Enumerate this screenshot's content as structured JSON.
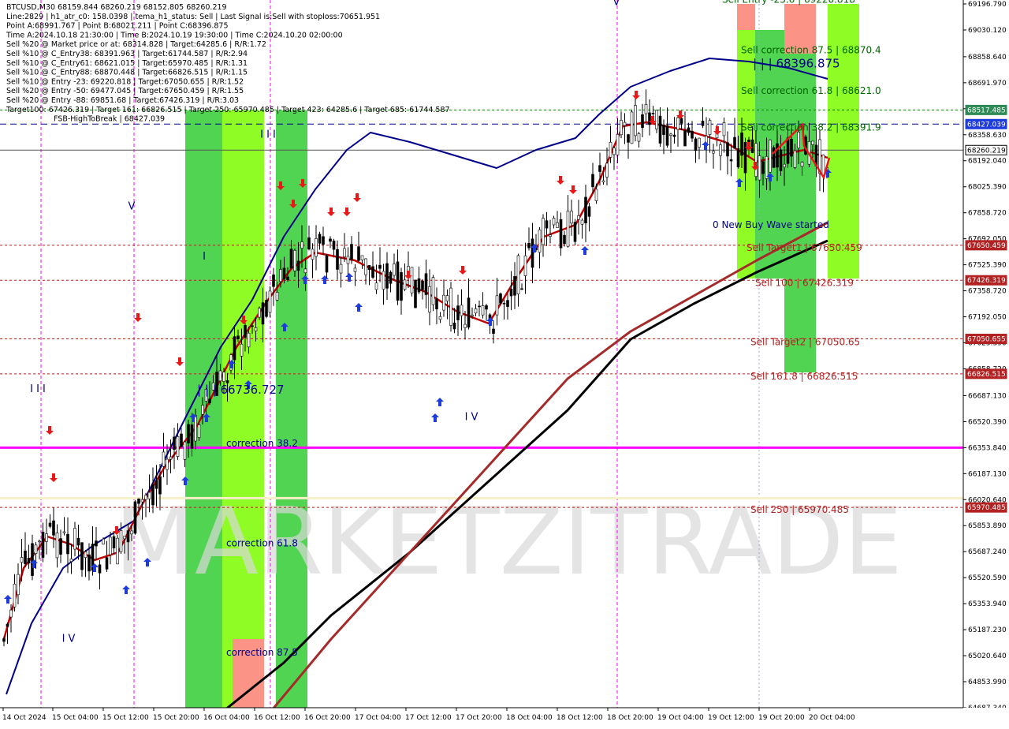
{
  "header_lines": [
    "BTCUSD,M30  68159.844 68260.219 68152.805 68260.219",
    "Line:2829  |  h1_atr_c0: 158.0398  |  tema_h1_status: Sell  |  Last Signal is:Sell with stoploss:70651.951",
    "Point A:68991.767  |  Point B:68021.211  |  Point C:68396.875",
    "Time A:2024.10.18 21:30:00  |  Time B:2024.10.19 19:30:00  |  Time C:2024.10.20 02:00:00",
    "Sell %20 @ Market price or at: 68314.828  |  Target:64285.6  |  R/R:1.72",
    "Sell %10 @ C_Entry38: 68391.963  |  Target:61744.587  |  R/R:2.94",
    "Sell %10 @ C_Entry61: 68621.015  |  Target:65970.485  |  R/R:1.31",
    "Sell %10 @ C_Entry88: 68870.448  |  Target:66826.515  |  R/R:1.15",
    "Sell %10 @ Entry -23: 69220.818  |  Target:67050.655  |  R/R:1.52",
    "Sell %20 @ Entry -50: 69477.045  |  Target:67650.459  |  R/R:1.55",
    "Sell %20 @ Entry -88: 69851.68  |  Target:67426.319  |  R/R:3.03",
    "Target100: 67426.319  |  Target 161: 66826.515  |  Target 250: 65970.485  |  Target 423: 64285.6  |  Target 685: 61744.587",
    "FSB-HighToBreak  |  68427.039"
  ],
  "watermark": "MARKETZITRADE",
  "colors": {
    "background": "#ffffff",
    "blue_ma": "#00008b",
    "red_ma": "#c00000",
    "brown_ma": "#a52a2a",
    "black_ma": "#000000",
    "magenta": "#ff00ff",
    "green_zone": "#32cd32",
    "lime_zone": "#7cfc00",
    "salmon_zone": "#fa8072",
    "level_text": "#b22222",
    "dark_blue_text": "#00008b"
  },
  "chart_data": {
    "type": "candlestick",
    "symbol": "BTCUSD",
    "timeframe": "M30",
    "ylim": [
      64687.34,
      69196.79
    ],
    "price_ticks": [
      "69196.790",
      "69030.120",
      "68858.640",
      "68691.970",
      "68525.300",
      "68358.630",
      "68192.040",
      "68025.390",
      "67858.720",
      "67692.050",
      "67525.390",
      "67358.720",
      "67192.050",
      "67025.390",
      "66858.720",
      "66687.130",
      "66520.390",
      "66353.840",
      "66187.130",
      "66020.640",
      "65853.890",
      "65687.240",
      "65520.590",
      "65353.940",
      "65187.230",
      "65020.640",
      "64853.990",
      "64687.340"
    ],
    "time_labels": [
      "14 Oct 2024",
      "15 Oct 04:00",
      "15 Oct 12:00",
      "15 Oct 20:00",
      "16 Oct 04:00",
      "16 Oct 12:00",
      "16 Oct 20:00",
      "17 Oct 04:00",
      "17 Oct 12:00",
      "17 Oct 20:00",
      "18 Oct 04:00",
      "18 Oct 12:00",
      "18 Oct 20:00",
      "19 Oct 04:00",
      "19 Oct 12:00",
      "19 Oct 20:00",
      "20 Oct 04:00"
    ],
    "horizontal_levels": [
      {
        "price": 68517.485,
        "label": "68517.485",
        "color": "#008000",
        "style": "dotted"
      },
      {
        "price": 68427.039,
        "label": "68427.039",
        "color": "#00008b",
        "style": "dashed"
      },
      {
        "price": 68260.219,
        "label": "68260.219",
        "color": "#555555",
        "style": "solid"
      },
      {
        "price": 67650.459,
        "label": "67650.459",
        "color": "#b22222",
        "style": "dotted"
      },
      {
        "price": 67426.319,
        "label": "67426.319",
        "color": "#b22222",
        "style": "dotted"
      },
      {
        "price": 67050.655,
        "label": "67050.655",
        "color": "#b22222",
        "style": "dotted"
      },
      {
        "price": 66826.515,
        "label": "66826.515",
        "color": "#b22222",
        "style": "dotted"
      },
      {
        "price": 65970.485,
        "label": "65970.485",
        "color": "#b22222",
        "style": "dotted"
      }
    ],
    "magenta_level": 66353.84,
    "cream_level": 66030,
    "level_annotations": [
      {
        "text": "Sell Entry -23.6 | 69220.818",
        "price": 69205,
        "color": "#006400"
      },
      {
        "text": "Sell correction 87.5 | 68870.4",
        "price": 68880,
        "color": "#006400"
      },
      {
        "text": "| | | 68396.875",
        "price": 68790,
        "color": "#000080"
      },
      {
        "text": "Sell correction 61.8 | 68621.0",
        "price": 68620,
        "color": "#006400"
      },
      {
        "text": "Sell correction 38.2 | 68391.9",
        "price": 68385,
        "color": "#006400"
      },
      {
        "text": "0 New Buy Wave started",
        "price": 67760,
        "color": "#00008b"
      },
      {
        "text": "Sell Target1 | 67650.459",
        "price": 67615,
        "color": "#b22222"
      },
      {
        "text": "Sell 100 | 67426.319",
        "price": 67390,
        "color": "#b22222"
      },
      {
        "text": "Sell Target2 | 67050.65",
        "price": 67010,
        "color": "#b22222"
      },
      {
        "text": "Sell 161.8 | 66826.515",
        "price": 66790,
        "color": "#b22222"
      },
      {
        "text": "Sell 250 | 65970.485",
        "price": 65935,
        "color": "#b22222"
      },
      {
        "text": "correction 38.2",
        "price": 66360,
        "color": "#00008b"
      },
      {
        "text": "correction 61.8",
        "price": 65720,
        "color": "#00008b"
      },
      {
        "text": "correction 87.5",
        "price": 65020,
        "color": "#00008b"
      },
      {
        "text": "| | | 66736.727",
        "price": 66700,
        "color": "#00008b"
      }
    ],
    "wave_labels": [
      {
        "text": "V",
        "price": 69190
      },
      {
        "text": "V",
        "price": 67880
      },
      {
        "text": "I I I",
        "price": 66710
      },
      {
        "text": "I V",
        "price": 65110
      },
      {
        "text": "I",
        "price": 67560
      },
      {
        "text": "I I I",
        "price": 68340
      },
      {
        "text": "I V",
        "price": 66530
      }
    ]
  }
}
